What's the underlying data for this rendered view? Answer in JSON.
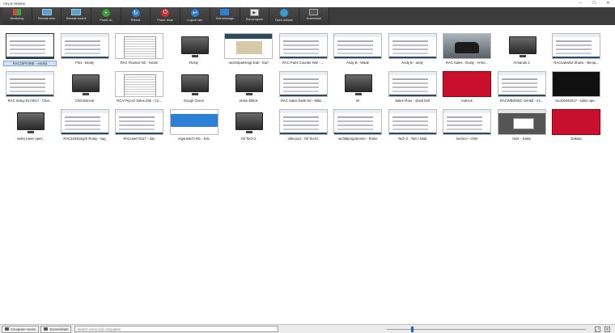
{
  "window": {
    "title": "Veyon Master",
    "controls": [
      "–",
      "☐",
      "✕"
    ]
  },
  "toolbar": [
    {
      "key": "monitoring",
      "label": "Monitoring",
      "icon": "monitoring-icon",
      "style": "grid"
    },
    {
      "key": "remote_view",
      "label": "Remote view",
      "icon": "remote-view-icon",
      "style": "rect"
    },
    {
      "key": "remote_control",
      "label": "Remote control",
      "icon": "remote-control-icon",
      "style": "rect"
    },
    {
      "key": "power_on",
      "label": "Power on",
      "icon": "power-on-icon",
      "style": "round-g",
      "glyph": "+"
    },
    {
      "key": "reboot",
      "label": "Reboot",
      "icon": "reboot-icon",
      "style": "round-b",
      "glyph": "↻"
    },
    {
      "key": "power_down",
      "label": "Power down",
      "icon": "power-down-icon",
      "style": "round-r",
      "glyph": "⏻"
    },
    {
      "key": "logout_user",
      "label": "Logout user",
      "icon": "logout-icon",
      "style": "round-b",
      "glyph": "↩"
    },
    {
      "key": "text_message",
      "label": "Text message",
      "icon": "message-icon",
      "style": "msg"
    },
    {
      "key": "run_program",
      "label": "Run program",
      "icon": "run-program-icon",
      "style": "run",
      "glyph": "▶"
    },
    {
      "key": "open_website",
      "label": "Open website",
      "icon": "globe-icon",
      "style": "web"
    },
    {
      "key": "screenshot",
      "label": "Screenshot",
      "icon": "screenshot-icon",
      "style": "shot"
    }
  ],
  "computers": [
    {
      "name": "RAC23PrntNE - Andria",
      "thumb": "desk",
      "selected": true
    },
    {
      "name": "Pin1 - Brody",
      "thumb": "desk"
    },
    {
      "name": "RAC Finance N2 - Nicole",
      "thumb": "doc"
    },
    {
      "name": "Rusty",
      "thumb": "off"
    },
    {
      "name": "rac024partsmgr Earl - Earl",
      "thumb": "web"
    },
    {
      "name": "RAC Parts Counter NW - ...",
      "thumb": "desk"
    },
    {
      "name": "Andy B - Wade",
      "thumb": "desk"
    },
    {
      "name": "Andy B - andy",
      "thumb": "desk"
    },
    {
      "name": "RAC Sales - Dusty - Armo...",
      "thumb": "car"
    },
    {
      "name": "Armando 2",
      "thumb": "off"
    },
    {
      "name": "RACsalesN2 Shane - Benja...",
      "thumb": "desk"
    },
    {
      "name": "RAC Setup 8172017 - Char...",
      "thumb": "desk"
    },
    {
      "name": "Clint Bolcout",
      "thumb": "off"
    },
    {
      "name": "RCA Pryce2 Sales Dsk - Cu...",
      "thumb": "doc"
    },
    {
      "name": "Dough Green",
      "thumb": "off"
    },
    {
      "name": "Jesse Elkins",
      "thumb": "off"
    },
    {
      "name": "RAC Sales Desk N2 - Mike ...",
      "thumb": "desk"
    },
    {
      "name": "eli",
      "thumb": "off"
    },
    {
      "name": "Sales Floor - david bell",
      "thumb": "desk"
    },
    {
      "name": "marcus",
      "thumb": "red"
    },
    {
      "name": "RACWBdSWC Gerald - mi...",
      "thumb": "desk"
    },
    {
      "name": "rac100042017 - sales ope...",
      "thumb": "dark"
    },
    {
      "name": "sales tower open",
      "thumb": "off"
    },
    {
      "name": "RAC104sbmgr0 Rusty - sag",
      "thumb": "desk"
    },
    {
      "name": "RACuser73117 - dan",
      "thumb": "desk"
    },
    {
      "name": "reganstech W1 - Eric",
      "thumb": "blue"
    },
    {
      "name": "Oil Tech 2",
      "thumb": "off"
    },
    {
      "name": "oiltecpc2 - Oil Tech1",
      "thumb": "desk"
    },
    {
      "name": "rac0Mprogrammer - Ronie",
      "thumb": "desk"
    },
    {
      "name": "Tech 2 - Tom / Matt",
      "thumb": "desk"
    },
    {
      "name": "Service - chris",
      "thumb": "desk"
    },
    {
      "name": "User - Sales",
      "thumb": "popup"
    },
    {
      "name": "Dakota",
      "thumb": "red"
    }
  ],
  "statusbar": {
    "computer_rooms_label": "Computer rooms",
    "screenshots_label": "Screenshots",
    "search_placeholder": "Search users and computers",
    "zoom_fraction": 0.12
  }
}
